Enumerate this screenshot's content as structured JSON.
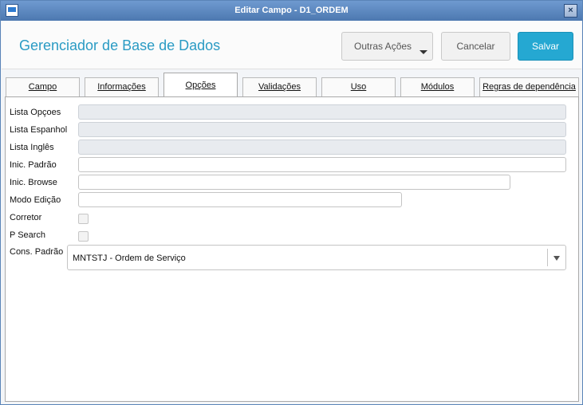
{
  "window": {
    "title": "Editar Campo - D1_ORDEM",
    "close_label": "×"
  },
  "header": {
    "page_title": "Gerenciador de Base de Dados",
    "outras_acoes": "Outras Ações",
    "cancelar": "Cancelar",
    "salvar": "Salvar"
  },
  "tabs": [
    {
      "label": "Campo"
    },
    {
      "label": "Informações"
    },
    {
      "label": "Opções",
      "active": true
    },
    {
      "label": "Validações"
    },
    {
      "label": "Uso"
    },
    {
      "label": "Módulos"
    },
    {
      "label": "Regras de dependência"
    }
  ],
  "form": {
    "lista_opcoes": {
      "label": "Lista Opçoes",
      "value": ""
    },
    "lista_espanhol": {
      "label": "Lista Espanhol",
      "value": ""
    },
    "lista_ingles": {
      "label": "Lista Inglês",
      "value": ""
    },
    "inic_padrao": {
      "label": "Inic. Padrão",
      "value": ""
    },
    "inic_browse": {
      "label": "Inic. Browse",
      "value": ""
    },
    "modo_edicao": {
      "label": "Modo Edição",
      "value": ""
    },
    "corretor": {
      "label": "Corretor",
      "checked": false
    },
    "p_search": {
      "label": "P Search",
      "checked": false
    },
    "cons_padrao": {
      "label": "Cons. Padrão",
      "value": "MNTSTJ - Ordem de Serviço"
    }
  },
  "colors": {
    "accent": "#2a9bc4",
    "primary_button": "#25a8d2",
    "titlebar": "#4c78b0"
  },
  "icons": {
    "window": "app-window-icon",
    "close": "close-icon",
    "dropdown": "chevron-down-icon"
  }
}
